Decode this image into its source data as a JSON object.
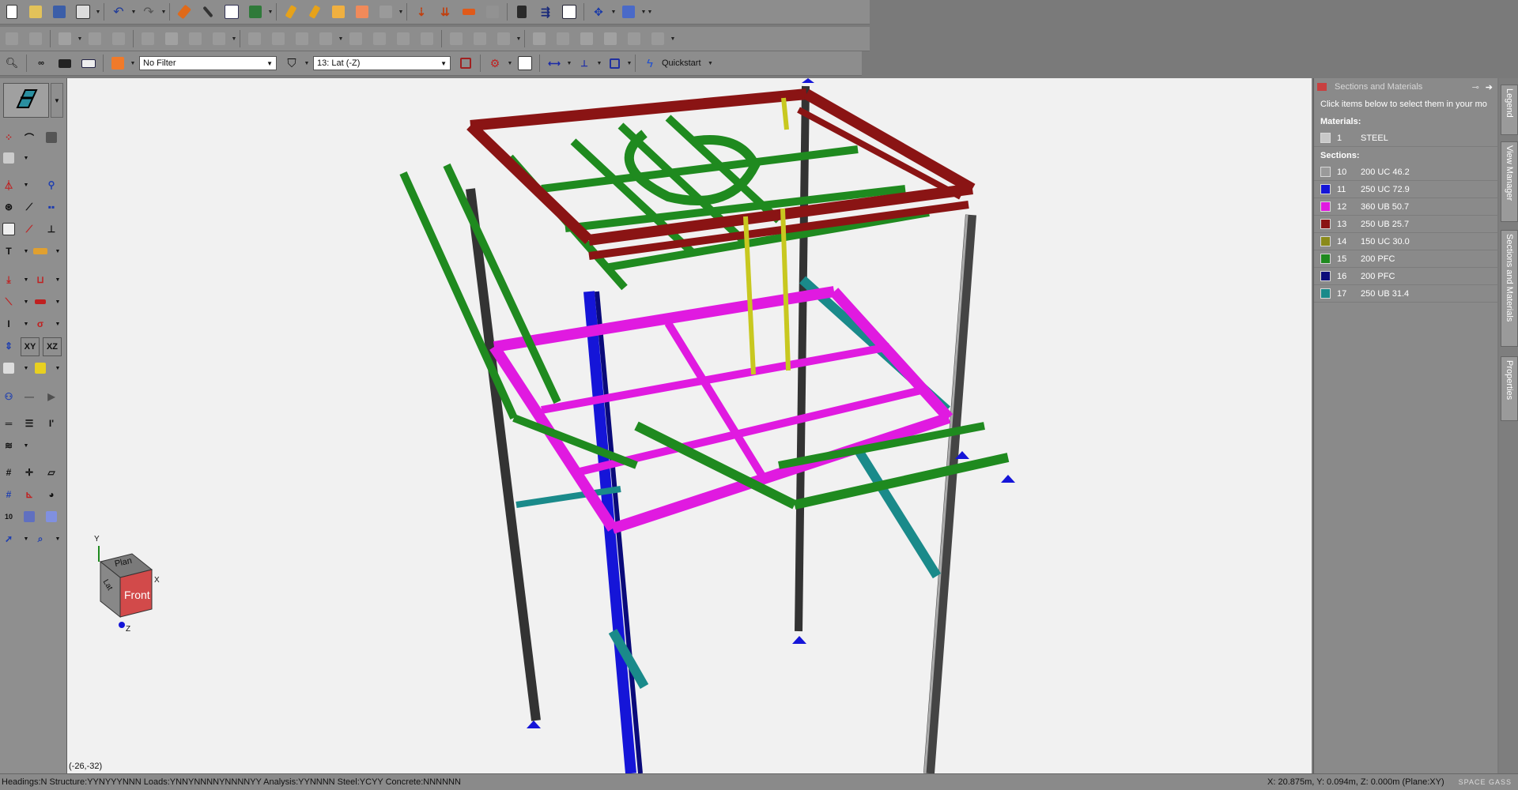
{
  "toolbar": {
    "filter_value": "No Filter",
    "view_value": "13: Lat (-Z)",
    "quickstart_label": "Quickstart"
  },
  "toolbox": {
    "xy_label": "XY",
    "xz_label": "XZ",
    "text_tool_label": "T"
  },
  "viewport": {
    "cursor_coords": "(-26,-32)",
    "viewcube": {
      "top": "Plan",
      "front": "Front",
      "side": "Lat",
      "axis_x": "X",
      "axis_y": "Y",
      "axis_z": "Z"
    }
  },
  "panel": {
    "title": "Sections and Materials",
    "hint": "Click items below to select them in your mo",
    "materials_label": "Materials:",
    "materials": [
      {
        "id": "1",
        "name": "STEEL",
        "color": "#c8c8c8"
      }
    ],
    "sections_label": "Sections:",
    "sections": [
      {
        "id": "10",
        "name": "200 UC 46.2",
        "color": "#9a9a9a"
      },
      {
        "id": "11",
        "name": "250 UC 72.9",
        "color": "#1515d8"
      },
      {
        "id": "12",
        "name": "360 UB 50.7",
        "color": "#e01ae0"
      },
      {
        "id": "13",
        "name": "250 UB 25.7",
        "color": "#8a1414"
      },
      {
        "id": "14",
        "name": "150 UC 30.0",
        "color": "#8a8a1a"
      },
      {
        "id": "15",
        "name": "200 PFC",
        "color": "#1f8a1f"
      },
      {
        "id": "16",
        "name": "200 PFC",
        "color": "#0c0c7a"
      },
      {
        "id": "17",
        "name": "250 UB 31.4",
        "color": "#1a8a8a"
      }
    ]
  },
  "side_tabs": [
    "Legend",
    "View Manager",
    "Sections and Materials",
    "Properties"
  ],
  "status": {
    "left": "Headings:N Structure:YYNYYYNNN Loads:YNNYNNNNYNNNNYY Analysis:YYNNNN Steel:YCYY Concrete:NNNNNN",
    "right": "X: 20.875m, Y: 0.094m, Z: 0.000m (Plane:XY)",
    "brand": "SPACE GASS"
  }
}
